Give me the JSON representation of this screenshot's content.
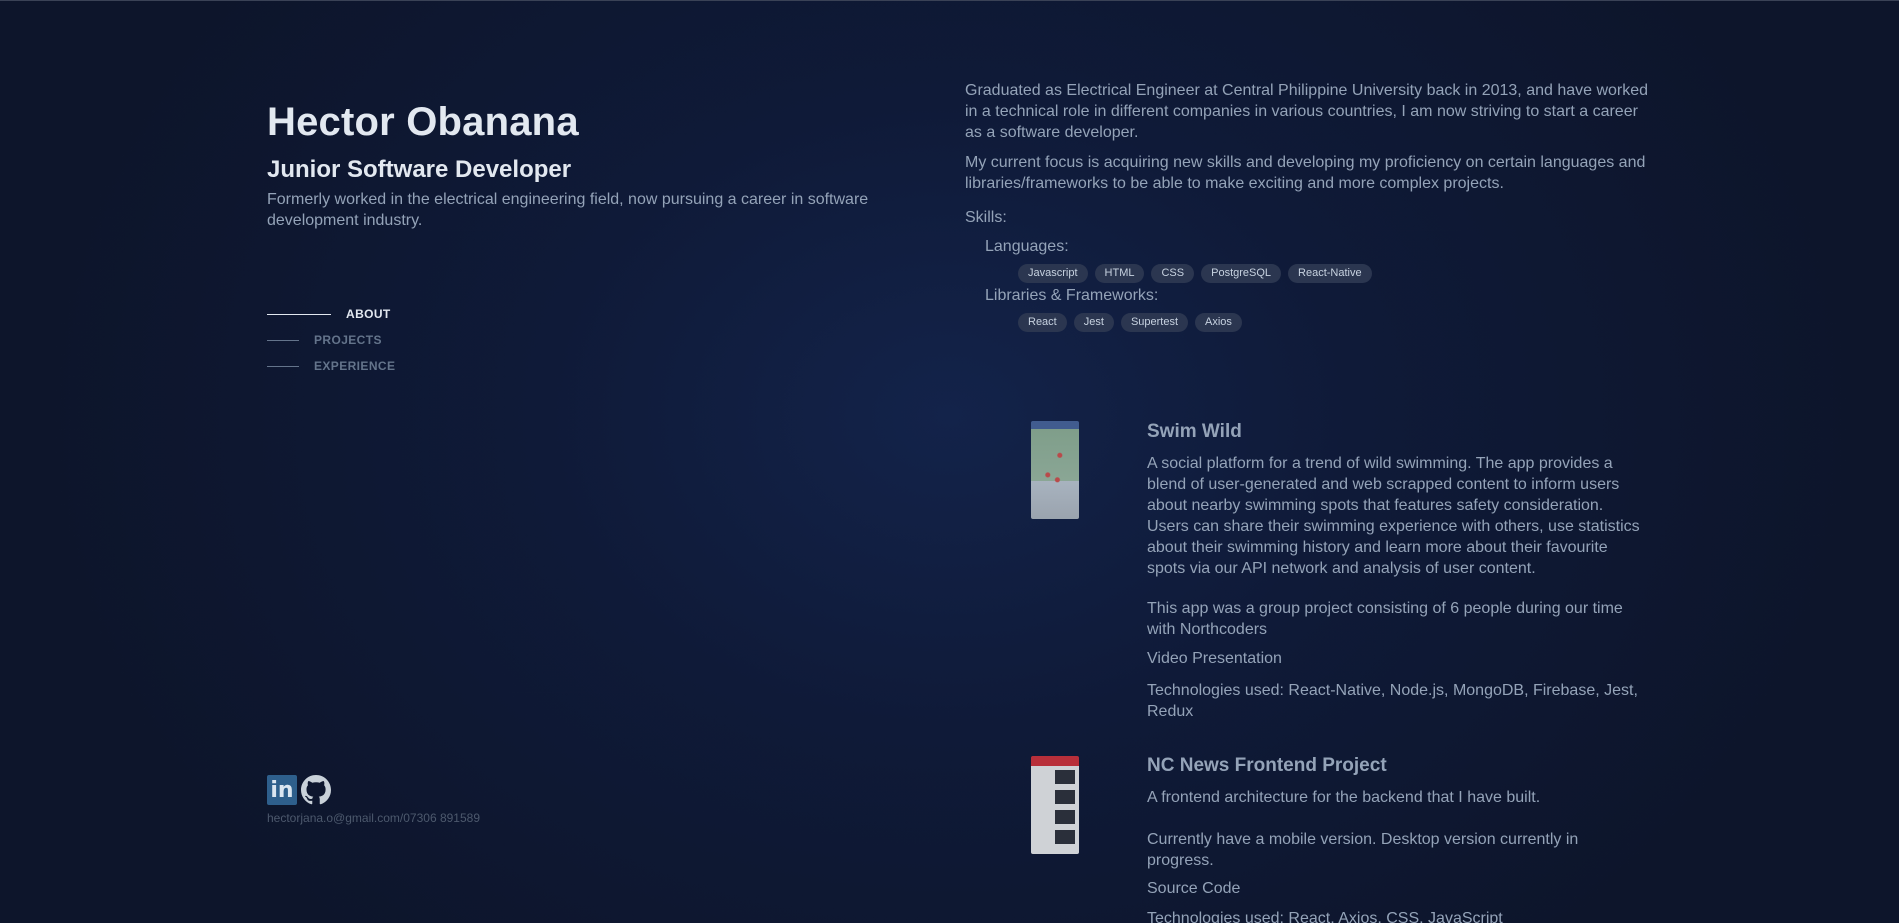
{
  "header": {
    "name": "Hector Obanana",
    "role": "Junior Software Developer",
    "intro": "Formerly worked in the electrical engineering field, now pursuing a career in software development industry."
  },
  "nav": {
    "items": [
      {
        "label": "ABOUT",
        "active": true
      },
      {
        "label": "PROJECTS",
        "active": false
      },
      {
        "label": "EXPERIENCE",
        "active": false
      }
    ]
  },
  "social": {
    "linkedin_icon": "linkedin-icon",
    "linkedin_text": "in",
    "github_icon": "github-icon",
    "contact": "hectorjana.o@gmail.com/07306 891589"
  },
  "about": {
    "paragraph1": "Graduated as Electrical Engineer at Central Philippine University back in 2013, and have worked in a technical role in different companies in various countries, I am now striving to start a career as a software developer.",
    "paragraph2": "My current focus is acquiring new skills and developing my proficiency on certain languages and libraries/frameworks to be able to make exciting and more complex projects.",
    "skills_label": "Skills:",
    "languages_label": "Languages:",
    "languages": [
      "Javascript",
      "HTML",
      "CSS",
      "PostgreSQL",
      "React-Native"
    ],
    "frameworks_label": "Libraries & Frameworks:",
    "frameworks": [
      "React",
      "Jest",
      "Supertest",
      "Axios"
    ]
  },
  "projects": [
    {
      "title": "Swim Wild",
      "description": "A social platform for a trend of wild swimming. The app provides a blend of user-generated and web scrapped content to inform users about nearby swimming spots that features safety consideration. Users can share their swimming experience with others, use statistics about their swimming history and learn more about their favourite spots via our API network and analysis of user content.",
      "note": "This app was a group project consisting of 6 people during our time with Northcoders",
      "link": "Video Presentation",
      "tech": "Technologies used: React-Native, Node.js, MongoDB, Firebase, Jest, Redux"
    },
    {
      "title": "NC News Frontend Project",
      "description": "A frontend architecture for the backend that I have built.",
      "note": "Currently have a mobile version. Desktop version currently in progress.",
      "link": "Source Code",
      "tech": "Technologies used: React, Axios, CSS, JavaScript"
    }
  ],
  "colors": {
    "background": "#0f172a",
    "heading": "#e2e8f0",
    "text": "#94a3b8",
    "pill_bg": "#2b3650"
  }
}
